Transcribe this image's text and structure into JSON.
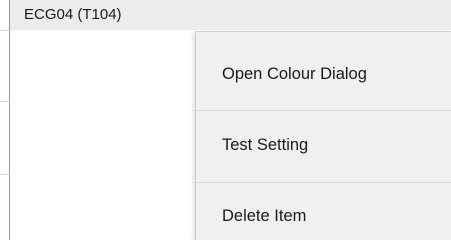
{
  "list": {
    "selected_item": "ECG04 (T104)"
  },
  "context_menu": {
    "items": [
      {
        "label": "Open Colour Dialog"
      },
      {
        "label": "Test Setting"
      },
      {
        "label": "Delete Item"
      }
    ]
  }
}
